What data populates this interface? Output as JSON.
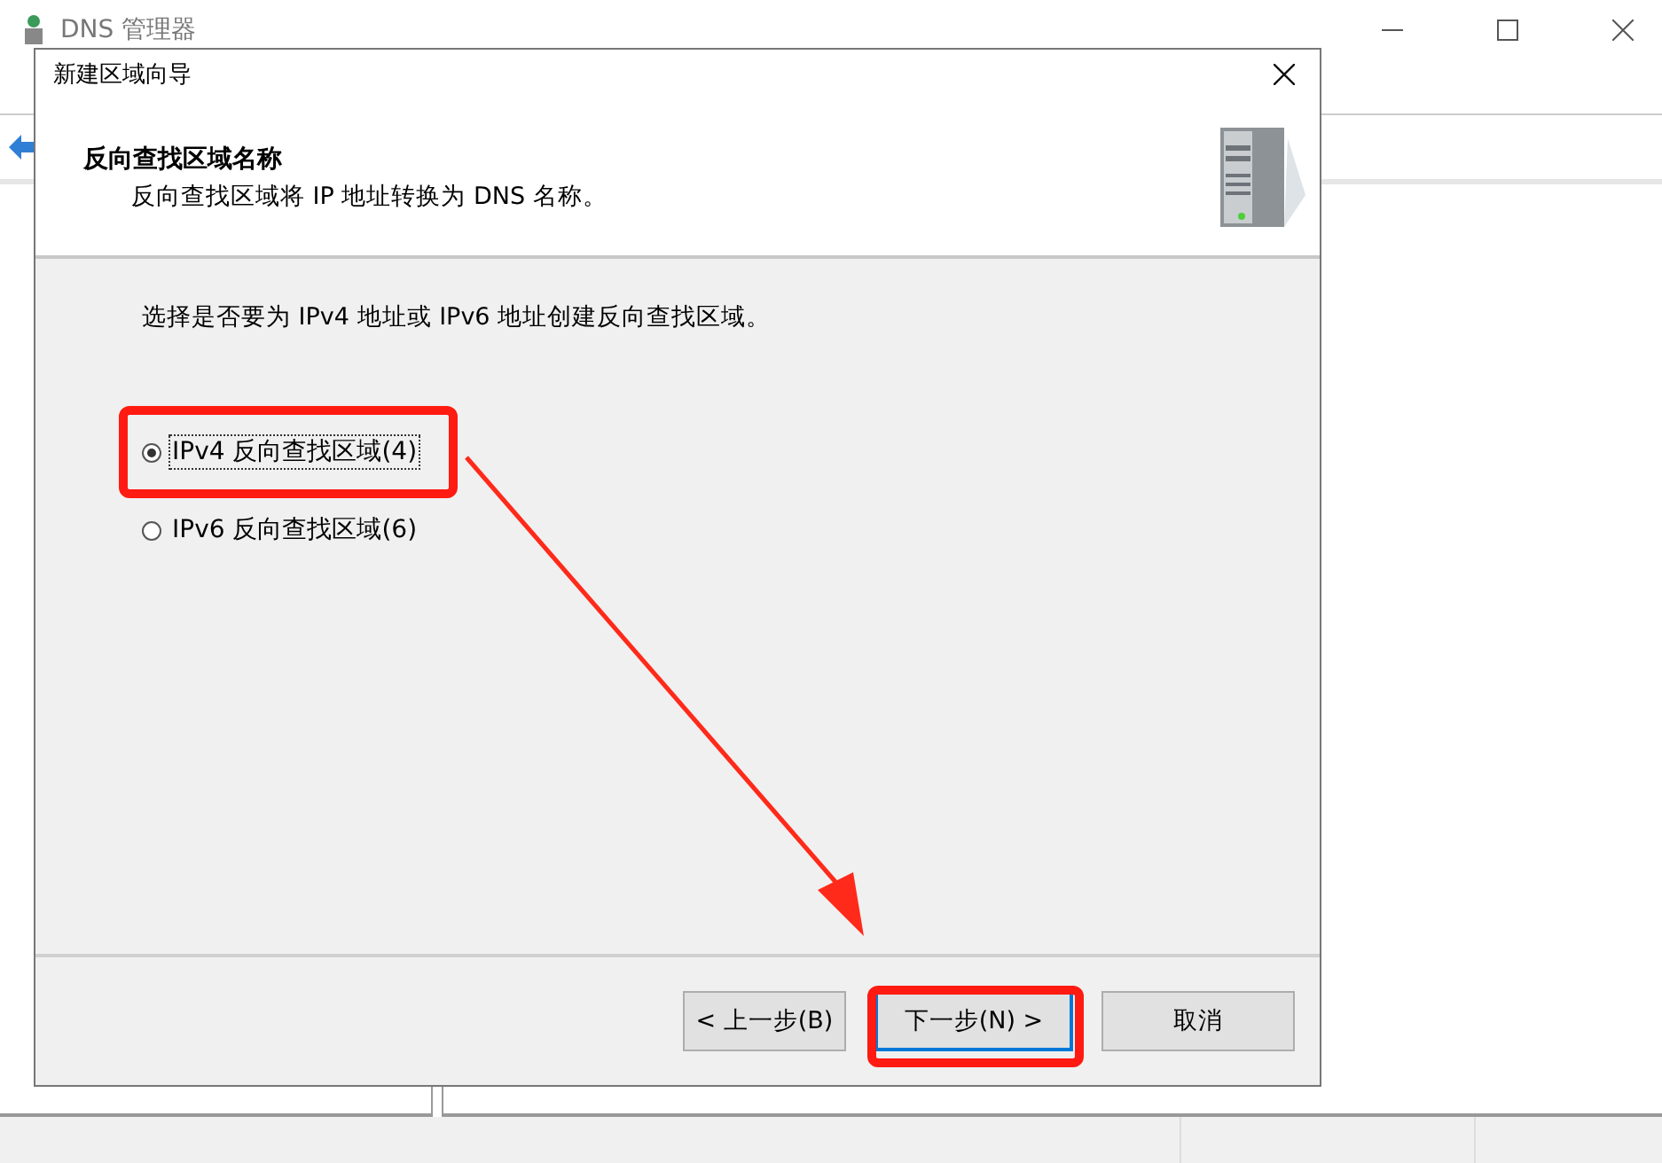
{
  "main_window": {
    "title": "DNS 管理器"
  },
  "dialog": {
    "title": "新建区域向导",
    "header_title": "反向查找区域名称",
    "header_subtitle": "反向查找区域将 IP 地址转换为 DNS 名称。",
    "prompt": "选择是否要为 IPv4 地址或 IPv6 地址创建反向查找区域。",
    "options": [
      {
        "label": "IPv4 反向查找区域(4)",
        "selected": true
      },
      {
        "label": "IPv6 反向查找区域(6)",
        "selected": false
      }
    ],
    "buttons": [
      {
        "label": "< 上一步(B)",
        "default": false
      },
      {
        "label": "下一步(N) >",
        "default": true
      },
      {
        "label": "取消",
        "default": false
      }
    ]
  }
}
